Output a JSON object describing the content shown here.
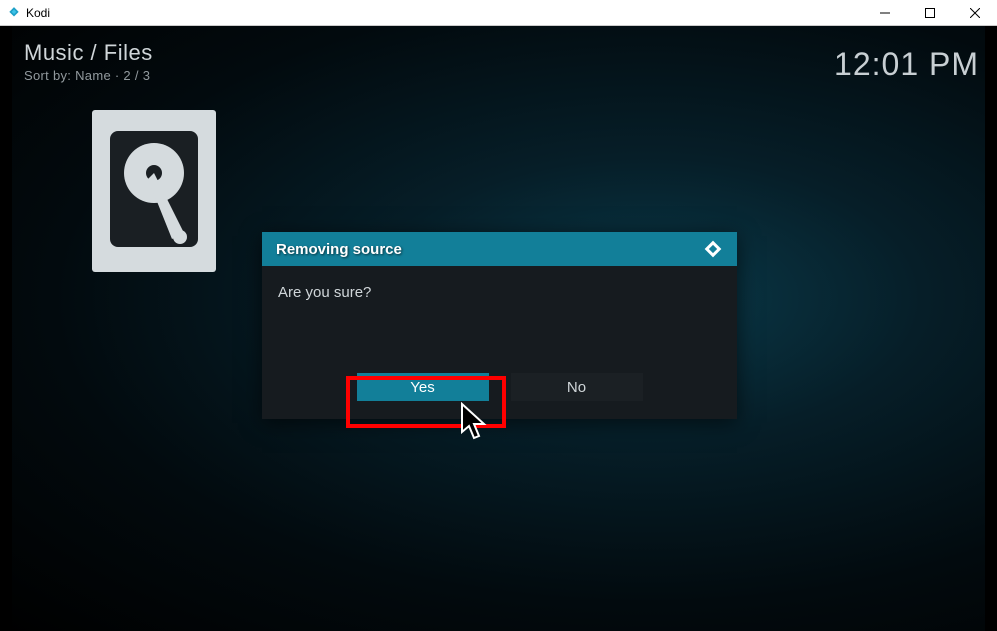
{
  "window": {
    "title": "Kodi"
  },
  "header": {
    "breadcrumb": "Music / Files",
    "sort": "Sort by: Name  ·  2 / 3",
    "clock": "12:01 PM"
  },
  "dialog": {
    "title": "Removing source",
    "message": "Are you sure?",
    "yes": "Yes",
    "no": "No"
  }
}
